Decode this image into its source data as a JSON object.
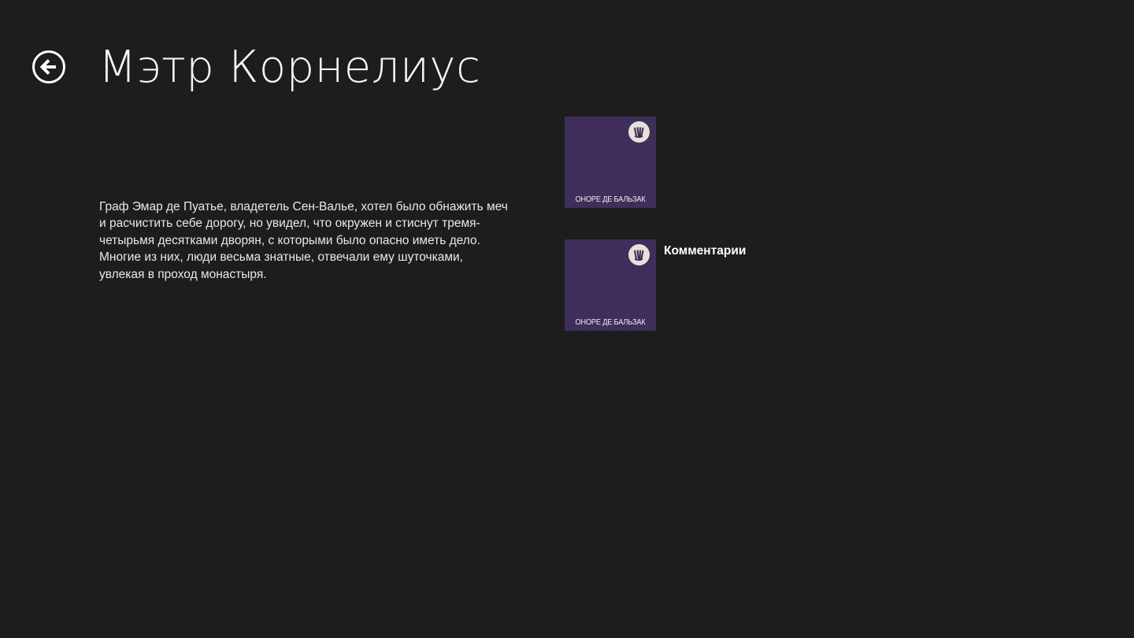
{
  "header": {
    "back_icon": "back-arrow-circle-icon",
    "title": "Мэтр Корнелиус"
  },
  "description": "Граф Эмар де Пуатье, владетель Сен-Валье, хотел было обнажить меч и расчистить себе дорогу, но увидел, что окружен и стиснут тремя-четырьмя десятками дворян, с которыми было опасно иметь дело. Многие из них, люди весьма знатные, отвечали ему шуточками, увлекая в проход монастыря.",
  "items": [
    {
      "cover_author": "ОНОРЕ ДЕ БАЛЬЗАК",
      "cover_logo_icon": "publisher-logo-icon",
      "label": ""
    },
    {
      "cover_author": "ОНОРЕ ДЕ БАЛЬЗАК",
      "cover_logo_icon": "publisher-logo-icon",
      "label": "Комментарии"
    }
  ],
  "colors": {
    "background": "#1d1d1d",
    "cover": "#3e2d59",
    "cover_logo": "#e5e2da",
    "text": "#ffffff"
  }
}
